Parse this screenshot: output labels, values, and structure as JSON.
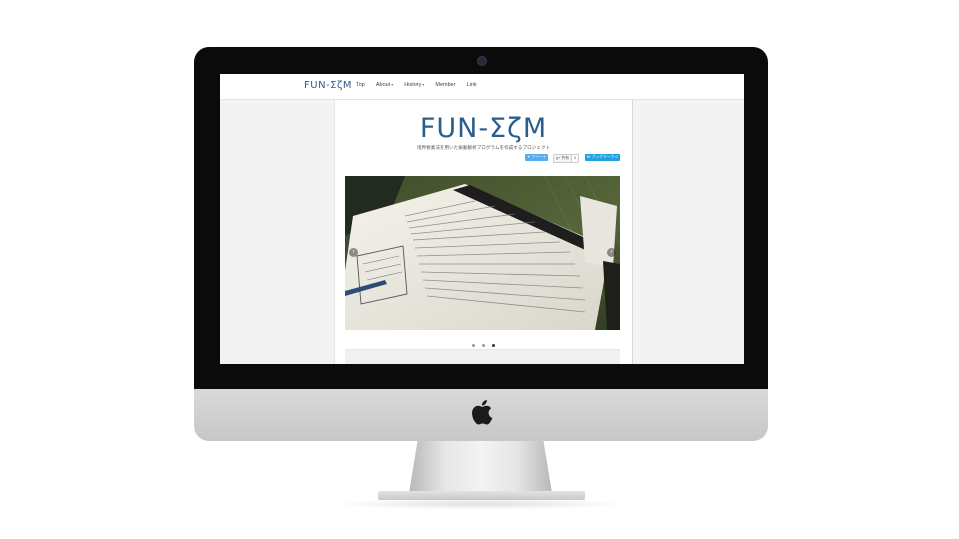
{
  "device": {
    "icons": {
      "brand": "apple-icon",
      "camera": "camera-icon"
    }
  },
  "site": {
    "nav": {
      "logo": "FUN-ΣζM",
      "items": [
        {
          "label": "Top",
          "has_dropdown": false
        },
        {
          "label": "About",
          "has_dropdown": true
        },
        {
          "label": "History",
          "has_dropdown": true
        },
        {
          "label": "Member",
          "has_dropdown": false
        },
        {
          "label": "Link",
          "has_dropdown": false
        }
      ],
      "dropdown_glyph": "▾"
    },
    "header": {
      "title": "FUN-ΣζM",
      "tagline": "境界要素法を用いた振動解析プログラムを作成するプロジェクト"
    },
    "share": {
      "tweet": "ツイート",
      "gplus": "共有",
      "gplus_count": "0",
      "hatena": "ブックマーク 0"
    },
    "slider": {
      "prev": "‹",
      "next": "›",
      "slide_count": 3,
      "active_index": 2
    },
    "colors": {
      "brand_blue": "#2c5d8f",
      "twitter": "#55acee",
      "hatena": "#1fa1e0"
    }
  }
}
